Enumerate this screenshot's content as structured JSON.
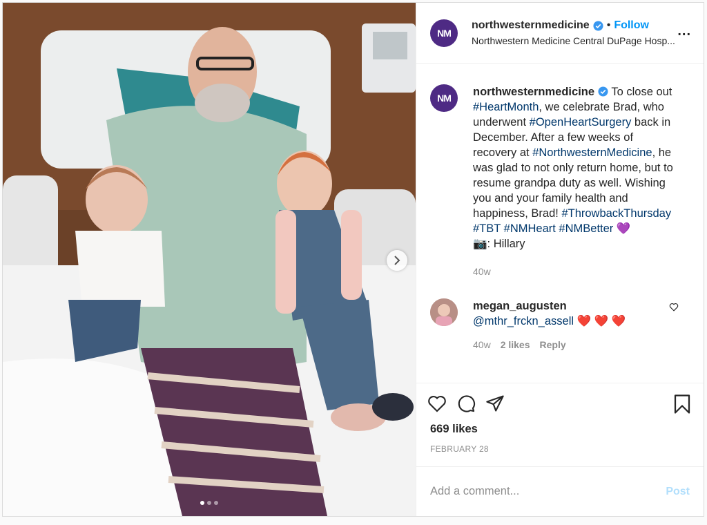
{
  "header": {
    "avatar_text": "NM",
    "username": "northwesternmedicine",
    "follow_label": "Follow",
    "separator": "•",
    "location": "Northwestern Medicine Central DuPage Hosp...",
    "more_label": "..."
  },
  "caption": {
    "username": "northwesternmedicine",
    "t1": "To close out",
    "h1": "#HeartMonth",
    "t2": ", we celebrate Brad, who underwent",
    "h2": "#OpenHeartSurgery",
    "t3": "back in December. After a few weeks of recovery at",
    "h3": "#NorthwesternMedicine",
    "t4": ", he was glad to not only return home, but to resume grandpa duty as well. Wishing you and your family health and happiness, Brad!",
    "h4": "#ThrowbackThursday",
    "h5": "#TBT",
    "h6": "#NMHeart",
    "h7": "#NMBetter",
    "emoji_heart": "💜",
    "camera_emoji": "📷",
    "credit": ": Hillary",
    "time": "40w"
  },
  "comment": {
    "username": "megan_augusten",
    "mention": "@mthr_frckn_assell",
    "hearts": "❤️ ❤️ ❤️",
    "time": "40w",
    "likes": "2 likes",
    "reply_label": "Reply"
  },
  "stats": {
    "likes": "669 likes",
    "date": "FEBRUARY 28"
  },
  "add_comment": {
    "placeholder": "Add a comment...",
    "post_label": "Post"
  },
  "carousel": {
    "current": 1,
    "total": 3
  },
  "colors": {
    "accent": "#0095f6",
    "hashtag": "#00376b",
    "brand_avatar": "#4e2a84",
    "muted": "#8e8e8e"
  },
  "icons": [
    "verified-badge-icon",
    "like-icon",
    "comment-icon",
    "share-icon",
    "save-icon",
    "more-options-icon",
    "chevron-right-icon"
  ]
}
